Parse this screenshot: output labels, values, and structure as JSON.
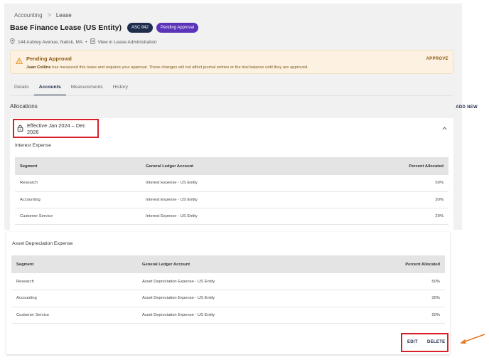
{
  "breadcrumb": {
    "parent": "Accounting",
    "separator": ">",
    "current": "Lease"
  },
  "header": {
    "title": "Base Finance Lease (US Entity)",
    "badges": [
      {
        "label": "ASC 842"
      },
      {
        "label": "Pending Approval"
      }
    ],
    "address": "144 Aubrey Avenue, Natick, MA",
    "dot": "•",
    "view_link": "View in Lease Administration"
  },
  "alert": {
    "title": "Pending Approval",
    "user": "Juan Collins",
    "message": "has measured this lease and requires your approval. These changes will not affect journal entries or the trial balance until they are approved.",
    "approve_label": "APPROVE"
  },
  "tabs": [
    {
      "label": "Details"
    },
    {
      "label": "Accounts",
      "active": true
    },
    {
      "label": "Measurements"
    },
    {
      "label": "History"
    }
  ],
  "allocations": {
    "label": "Allocations",
    "add_new": "ADD NEW",
    "effective": "Effective Jan 2024 – Dec 2026",
    "columns": [
      "Segment",
      "General Ledger Account",
      "Percent Allocated"
    ],
    "interest": {
      "title": "Interest Expense",
      "rows": [
        {
          "segment": "Research",
          "account": "Interest Expense - US Entity",
          "pct": "50%"
        },
        {
          "segment": "Accounting",
          "account": "Interest Expense - US Entity",
          "pct": "30%"
        },
        {
          "segment": "Customer Service",
          "account": "Interest Expense - US Entity",
          "pct": "20%"
        }
      ]
    },
    "depreciation": {
      "title": "Asset Depreciation Expense",
      "rows": [
        {
          "segment": "Research",
          "account": "Asset Depreciation Expense - US Entity",
          "pct": "50%"
        },
        {
          "segment": "Accounting",
          "account": "Asset Depreciation Expense - US Entity",
          "pct": "30%"
        },
        {
          "segment": "Customer Service",
          "account": "Asset Depreciation Expense - US Entity",
          "pct": "20%"
        }
      ]
    },
    "edit_label": "EDIT",
    "delete_label": "DELETE"
  },
  "colors": {
    "navy": "#1f2d4d",
    "purple": "#5b33b8",
    "highlight": "#d81e28",
    "arrow": "#e87722",
    "alert_bg": "#fdf2e1"
  },
  "icons": [
    "location-pin-icon",
    "building-icon",
    "warning-icon",
    "lock-icon",
    "chevron-up-icon",
    "arrow-icon"
  ]
}
